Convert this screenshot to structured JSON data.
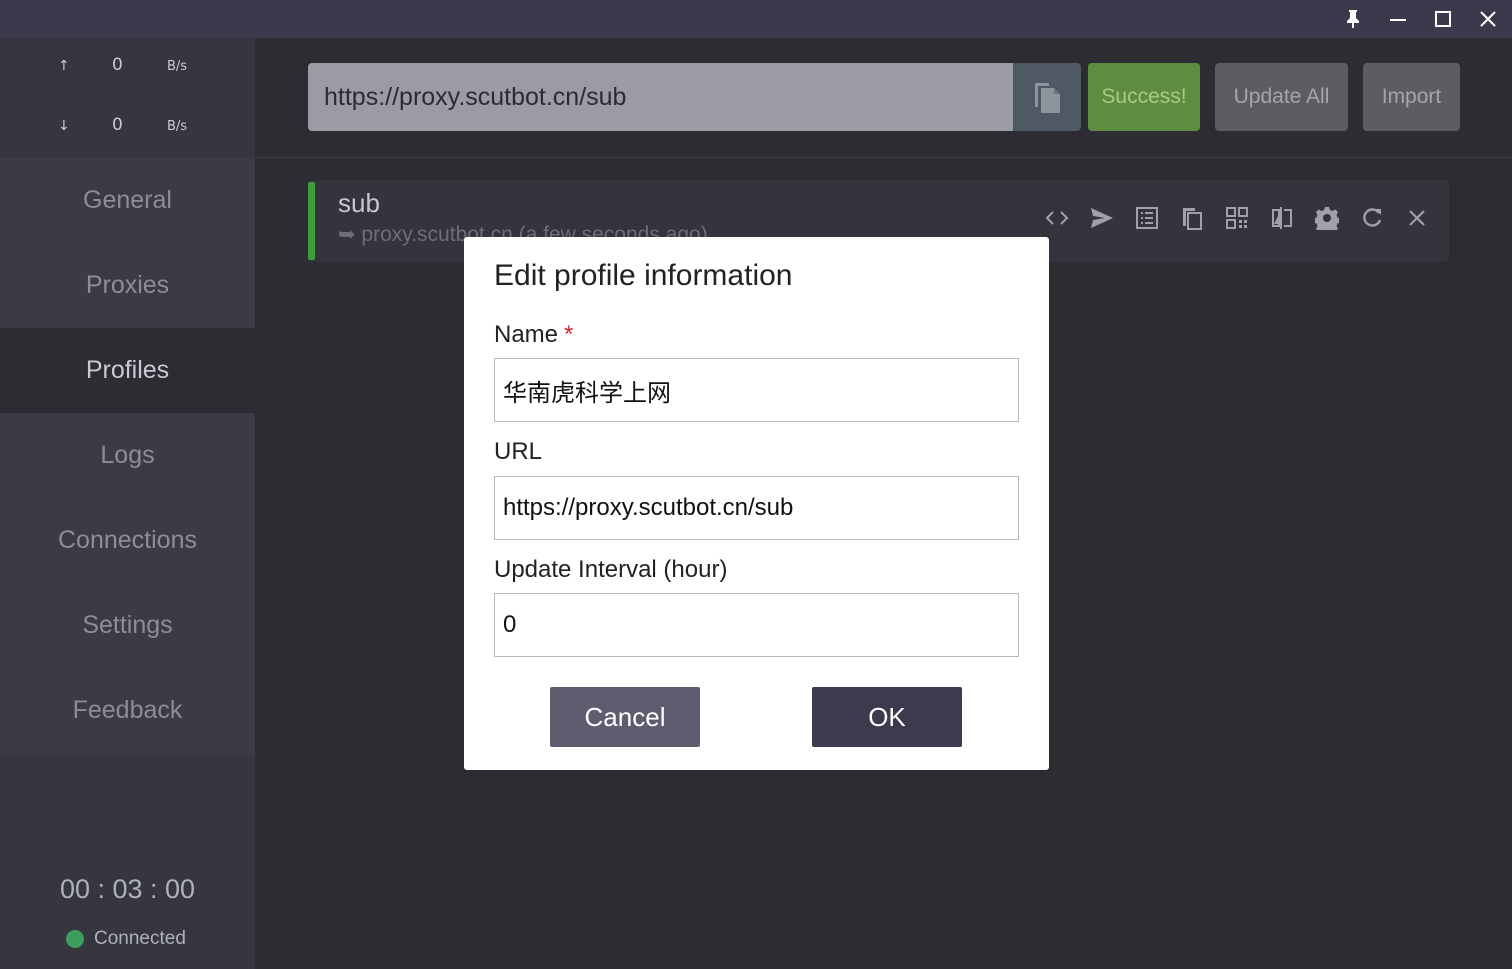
{
  "window": {
    "controls": [
      "pin-icon",
      "minimize-icon",
      "maximize-icon",
      "close-icon"
    ]
  },
  "sidebar": {
    "traffic": {
      "upload": {
        "arrow": "↑",
        "value": "0",
        "unit": "B/s"
      },
      "download": {
        "arrow": "↓",
        "value": "0",
        "unit": "B/s"
      }
    },
    "items": [
      {
        "label": "General"
      },
      {
        "label": "Proxies"
      },
      {
        "label": "Profiles",
        "active": true
      },
      {
        "label": "Logs"
      },
      {
        "label": "Connections"
      },
      {
        "label": "Settings"
      },
      {
        "label": "Feedback"
      }
    ],
    "timer": "00 : 03 : 00",
    "status": "Connected",
    "status_color": "#3c9e5a"
  },
  "toolbar": {
    "url_value": "https://proxy.scutbot.cn/sub",
    "copy_icon": "clipboard-icon",
    "success_label": "Success!",
    "update_all_label": "Update All",
    "import_label": "Import",
    "success_color": "#5e8d3f"
  },
  "profile": {
    "name": "sub",
    "source": "➥ proxy.scutbot.cn (a few seconds ago)",
    "active_color": "#3c9e3c",
    "actions": [
      "code-icon",
      "send-icon",
      "list-icon",
      "copy-icon",
      "qr-code-icon",
      "compare-icon",
      "settings-icon",
      "refresh-icon",
      "close-icon"
    ]
  },
  "modal": {
    "title": "Edit profile information",
    "name_label": "Name",
    "required_mark": "*",
    "name_value": "华南虎科学上网",
    "url_label": "URL",
    "url_value": "https://proxy.scutbot.cn/sub",
    "interval_label": "Update Interval (hour)",
    "interval_value": "0",
    "cancel_label": "Cancel",
    "ok_label": "OK"
  }
}
